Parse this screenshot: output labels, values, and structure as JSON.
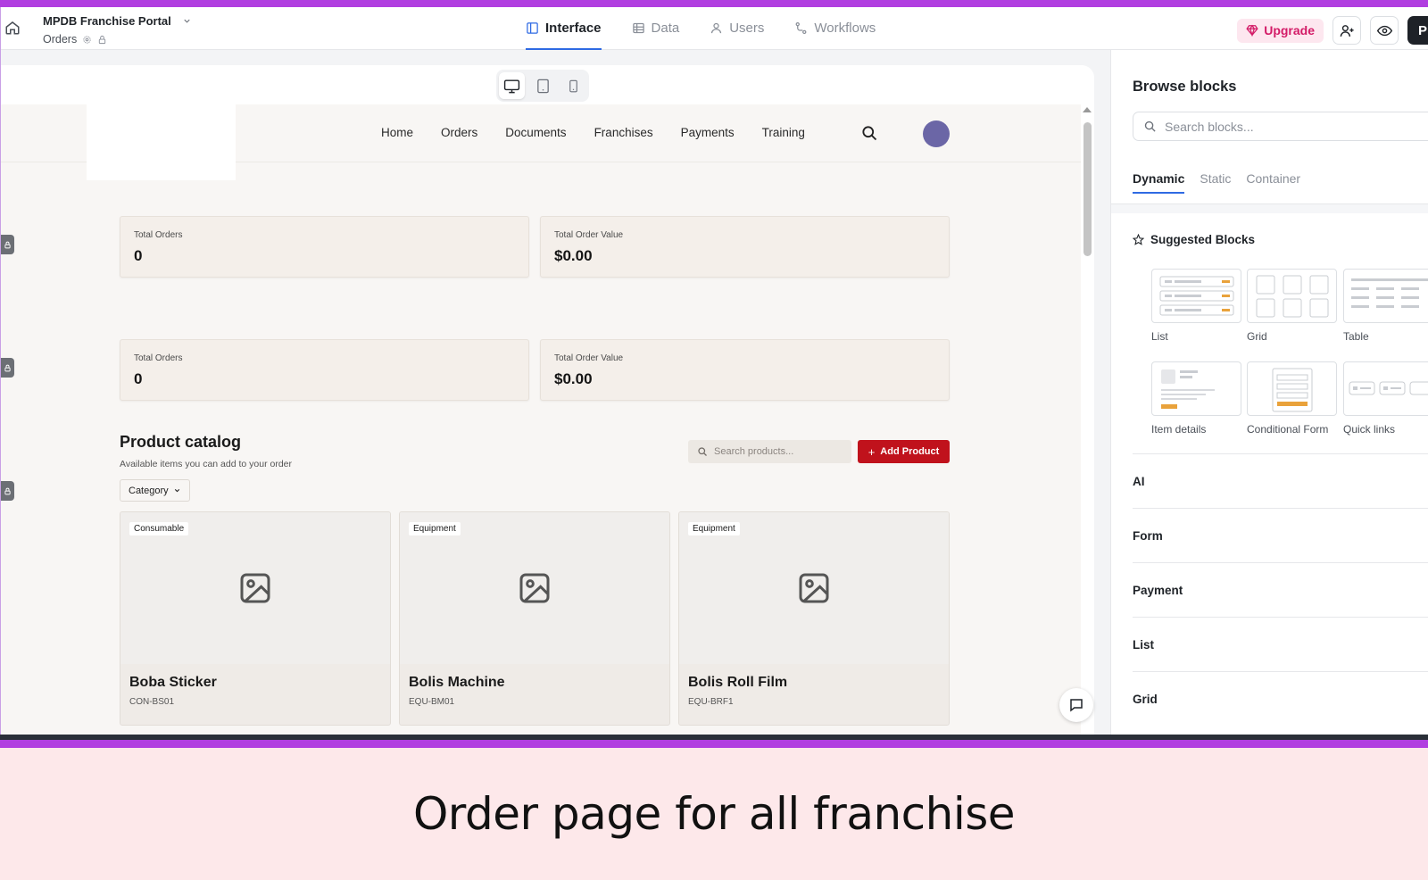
{
  "header": {
    "app_title": "MPDB Franchise Portal",
    "page_name": "Orders",
    "tabs": [
      {
        "label": "Interface",
        "icon": "layout-icon",
        "active": true
      },
      {
        "label": "Data",
        "icon": "table-icon",
        "active": false
      },
      {
        "label": "Users",
        "icon": "user-icon",
        "active": false
      },
      {
        "label": "Workflows",
        "icon": "workflow-icon",
        "active": false
      }
    ],
    "upgrade_label": "Upgrade",
    "profile_initial": "P"
  },
  "preview": {
    "nav": [
      "Home",
      "Orders",
      "Documents",
      "Franchises",
      "Payments",
      "Training"
    ],
    "stats_row1": [
      {
        "label": "Total Orders",
        "value": "0"
      },
      {
        "label": "Total Order Value",
        "value": "$0.00"
      }
    ],
    "stats_row2": [
      {
        "label": "Total Orders",
        "value": "0"
      },
      {
        "label": "Total Order Value",
        "value": "$0.00"
      }
    ],
    "catalog": {
      "title": "Product catalog",
      "subtitle": "Available items you can add to your order",
      "category_label": "Category",
      "search_placeholder": "Search products...",
      "add_button": "Add Product",
      "products": [
        {
          "badge": "Consumable",
          "name": "Boba Sticker",
          "sku": "CON-BS01"
        },
        {
          "badge": "Equipment",
          "name": "Bolis Machine",
          "sku": "EQU-BM01"
        },
        {
          "badge": "Equipment",
          "name": "Bolis Roll Film",
          "sku": "EQU-BRF1"
        }
      ]
    }
  },
  "panel": {
    "title": "Browse blocks",
    "search_placeholder": "Search blocks...",
    "tabs": [
      "Dynamic",
      "Static",
      "Container"
    ],
    "suggested_title": "Suggested Blocks",
    "suggested": [
      "List",
      "Grid",
      "Table",
      "Item details",
      "Conditional Form",
      "Quick links"
    ],
    "categories": [
      "AI",
      "Form",
      "Payment",
      "List",
      "Grid"
    ]
  },
  "colors": {
    "accent": "#2f6ae3",
    "brand_red": "#c0121c",
    "upgrade_pink": "#d31b67",
    "frame_purple": "#b13ee0"
  },
  "caption": "Order page for all franchise"
}
